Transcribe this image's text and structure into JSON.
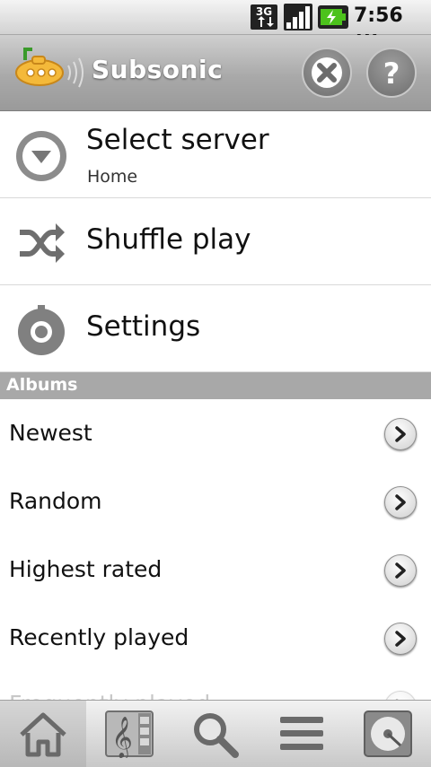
{
  "status_bar": {
    "network": "3G",
    "time": "7:56",
    "ampm": "AM",
    "icons": [
      "3g-data-icon",
      "signal-strength-icon",
      "battery-charging-icon"
    ]
  },
  "header": {
    "app_title": "Subsonic",
    "logo_icon": "submarine-logo-icon",
    "actions": [
      "close-icon",
      "help-icon"
    ]
  },
  "menu": {
    "select_server": {
      "label": "Select server",
      "value": "Home",
      "icon": "dropdown-circle-icon"
    },
    "shuffle": {
      "label": "Shuffle play",
      "icon": "shuffle-icon"
    },
    "settings": {
      "label": "Settings",
      "icon": "settings-knob-icon"
    }
  },
  "albums": {
    "header": "Albums",
    "items": [
      {
        "label": "Newest"
      },
      {
        "label": "Random"
      },
      {
        "label": "Highest rated"
      },
      {
        "label": "Recently played"
      },
      {
        "label": "Frequently played"
      }
    ]
  },
  "toolbar": {
    "tabs": [
      "home-icon",
      "music-library-icon",
      "search-icon",
      "playlists-icon",
      "now-playing-icon"
    ],
    "active": "home-icon"
  },
  "colors": {
    "header_gradient": "#a9a9a9",
    "section_bg": "#a8a8a8",
    "logo_yellow": "#f4b93a"
  }
}
